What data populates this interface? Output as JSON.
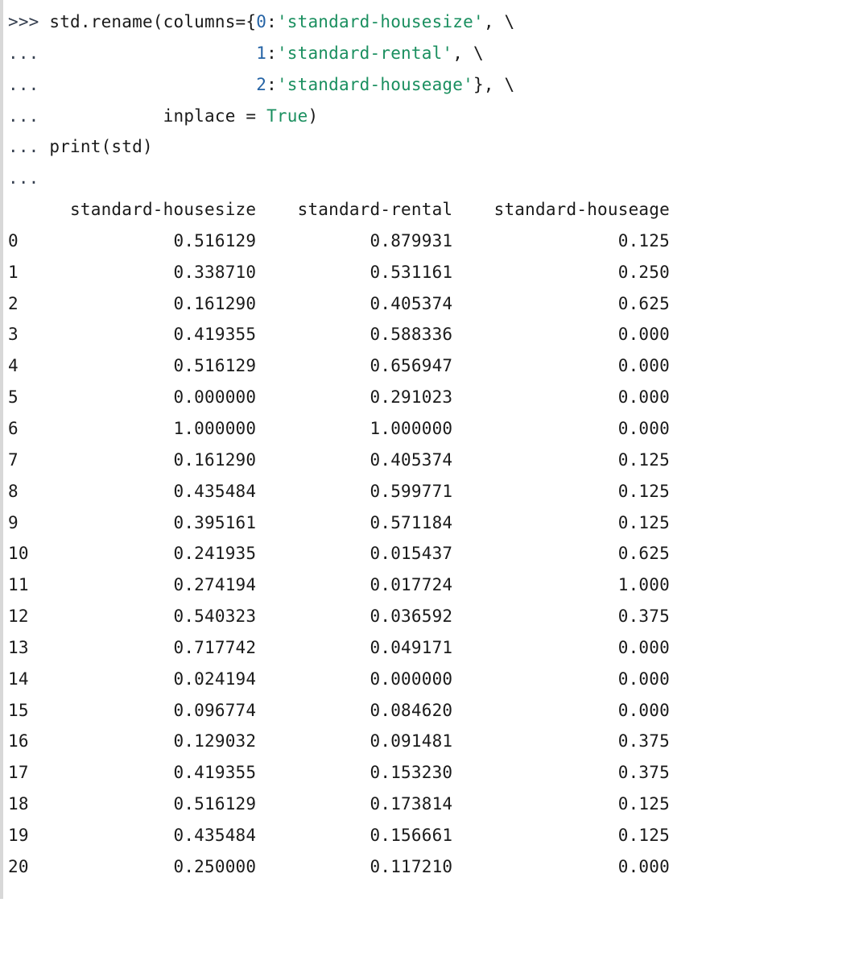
{
  "prompts": {
    "primary": ">>>",
    "cont": "..."
  },
  "code": {
    "line1_a": "std.rename(columns={",
    "line1_num": "0",
    "line1_b": ":",
    "line1_str": "'standard-housesize'",
    "line1_c": ", \\",
    "line2_num": "1",
    "line2_a": ":",
    "line2_str": "'standard-rental'",
    "line2_b": ", \\",
    "line3_num": "2",
    "line3_a": ":",
    "line3_str": "'standard-houseage'",
    "line3_b": "}, \\",
    "line4_a": "inplace = ",
    "line4_const": "True",
    "line4_b": ")",
    "line5": "print(std)"
  },
  "output": {
    "header_col0": "standard-housesize",
    "header_col1": "standard-rental",
    "header_col2": "standard-houseage",
    "rows": [
      {
        "idx": "0",
        "c0": "0.516129",
        "c1": "0.879931",
        "c2": "0.125"
      },
      {
        "idx": "1",
        "c0": "0.338710",
        "c1": "0.531161",
        "c2": "0.250"
      },
      {
        "idx": "2",
        "c0": "0.161290",
        "c1": "0.405374",
        "c2": "0.625"
      },
      {
        "idx": "3",
        "c0": "0.419355",
        "c1": "0.588336",
        "c2": "0.000"
      },
      {
        "idx": "4",
        "c0": "0.516129",
        "c1": "0.656947",
        "c2": "0.000"
      },
      {
        "idx": "5",
        "c0": "0.000000",
        "c1": "0.291023",
        "c2": "0.000"
      },
      {
        "idx": "6",
        "c0": "1.000000",
        "c1": "1.000000",
        "c2": "0.000"
      },
      {
        "idx": "7",
        "c0": "0.161290",
        "c1": "0.405374",
        "c2": "0.125"
      },
      {
        "idx": "8",
        "c0": "0.435484",
        "c1": "0.599771",
        "c2": "0.125"
      },
      {
        "idx": "9",
        "c0": "0.395161",
        "c1": "0.571184",
        "c2": "0.125"
      },
      {
        "idx": "10",
        "c0": "0.241935",
        "c1": "0.015437",
        "c2": "0.625"
      },
      {
        "idx": "11",
        "c0": "0.274194",
        "c1": "0.017724",
        "c2": "1.000"
      },
      {
        "idx": "12",
        "c0": "0.540323",
        "c1": "0.036592",
        "c2": "0.375"
      },
      {
        "idx": "13",
        "c0": "0.717742",
        "c1": "0.049171",
        "c2": "0.000"
      },
      {
        "idx": "14",
        "c0": "0.024194",
        "c1": "0.000000",
        "c2": "0.000"
      },
      {
        "idx": "15",
        "c0": "0.096774",
        "c1": "0.084620",
        "c2": "0.000"
      },
      {
        "idx": "16",
        "c0": "0.129032",
        "c1": "0.091481",
        "c2": "0.375"
      },
      {
        "idx": "17",
        "c0": "0.419355",
        "c1": "0.153230",
        "c2": "0.375"
      },
      {
        "idx": "18",
        "c0": "0.516129",
        "c1": "0.173814",
        "c2": "0.125"
      },
      {
        "idx": "19",
        "c0": "0.435484",
        "c1": "0.156661",
        "c2": "0.125"
      },
      {
        "idx": "20",
        "c0": "0.250000",
        "c1": "0.117210",
        "c2": "0.000"
      }
    ]
  }
}
